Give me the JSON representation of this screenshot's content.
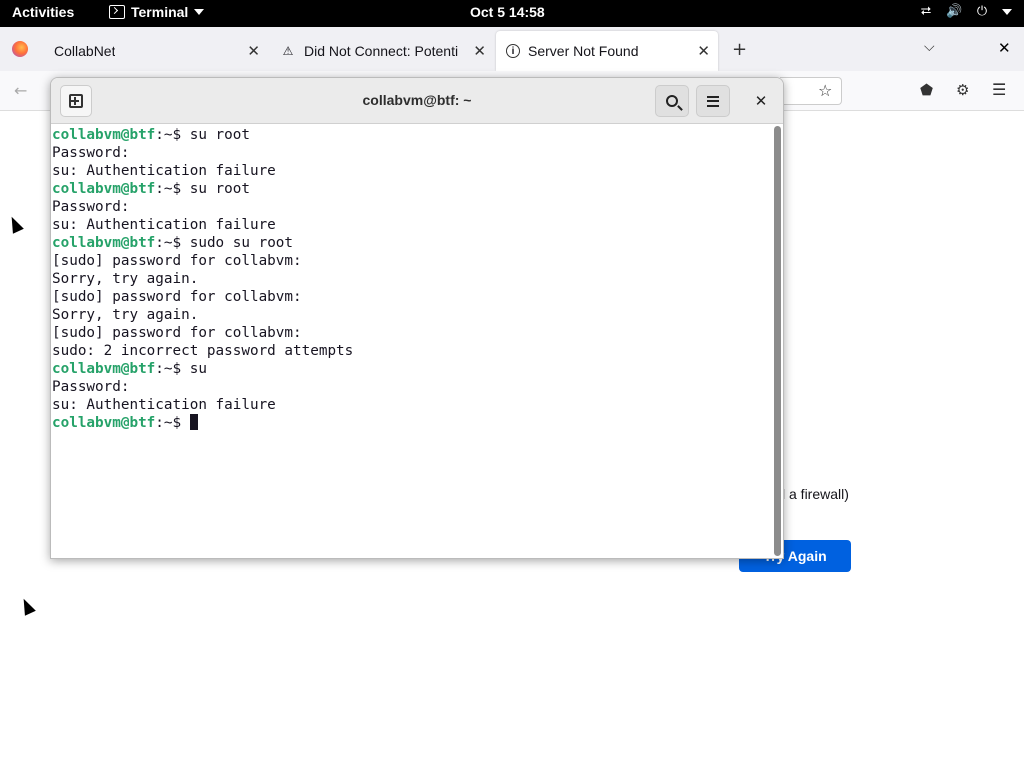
{
  "topbar": {
    "activities": "Activities",
    "app_name": "Terminal",
    "clock": "Oct 5  14:58",
    "status_icons": [
      "network-icon",
      "volume-icon",
      "power-icon",
      "system-menu-caret"
    ]
  },
  "firefox": {
    "tabs": [
      {
        "label": "CollabNet",
        "icon": "none"
      },
      {
        "label": "Did Not Connect: Potenti",
        "icon": "warning-icon"
      },
      {
        "label": "Server Not Found",
        "icon": "info-icon"
      }
    ],
    "page": {
      "visible_text_fragment": "l a firewall)",
      "try_again_label": "Try Again"
    }
  },
  "terminal": {
    "title": "collabvm@btf: ~",
    "lines": [
      {
        "prompt": "collabvm@btf",
        "path": ":~$ ",
        "text": "su root"
      },
      {
        "prompt": "",
        "path": "",
        "text": "Password:"
      },
      {
        "prompt": "",
        "path": "",
        "text": "su: Authentication failure"
      },
      {
        "prompt": "collabvm@btf",
        "path": ":~$ ",
        "text": "su root"
      },
      {
        "prompt": "",
        "path": "",
        "text": "Password:"
      },
      {
        "prompt": "",
        "path": "",
        "text": "su: Authentication failure"
      },
      {
        "prompt": "collabvm@btf",
        "path": ":~$ ",
        "text": "sudo su root"
      },
      {
        "prompt": "",
        "path": "",
        "text": "[sudo] password for collabvm:"
      },
      {
        "prompt": "",
        "path": "",
        "text": "Sorry, try again."
      },
      {
        "prompt": "",
        "path": "",
        "text": "[sudo] password for collabvm:"
      },
      {
        "prompt": "",
        "path": "",
        "text": "Sorry, try again."
      },
      {
        "prompt": "",
        "path": "",
        "text": "[sudo] password for collabvm:"
      },
      {
        "prompt": "",
        "path": "",
        "text": "sudo: 2 incorrect password attempts"
      },
      {
        "prompt": "collabvm@btf",
        "path": ":~$ ",
        "text": "su"
      },
      {
        "prompt": "",
        "path": "",
        "text": "Password:"
      },
      {
        "prompt": "",
        "path": "",
        "text": "su: Authentication failure"
      },
      {
        "prompt": "collabvm@btf",
        "path": ":~$ ",
        "text": ""
      }
    ]
  },
  "colors": {
    "prompt_green": "#26a269",
    "try_again_blue": "#0061e0",
    "topbar_bg": "#000000"
  }
}
